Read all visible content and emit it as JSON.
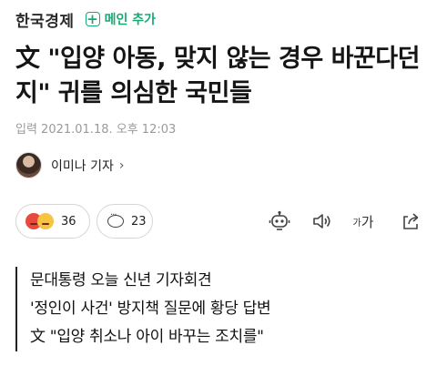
{
  "header": {
    "logo": "한국경제",
    "add_main_icon": "plus-icon",
    "add_main_label": "메인 추가",
    "accent_color": "#19a974"
  },
  "article": {
    "headline": "文 \"입양 아동, 맞지 않는 경우 바꾼다던지\" 귀를 의심한 국민들",
    "date": "입력 2021.01.18. 오후 12:03",
    "author": {
      "name": "이미나 기자",
      "chevron": "›"
    }
  },
  "actions": {
    "reactions": {
      "icons": [
        "angry-face-icon",
        "laughing-face-icon"
      ],
      "count": "36"
    },
    "comments": {
      "icon": "speech-bubble-icon",
      "count": "23"
    },
    "tools": [
      {
        "name": "robot-summary-icon"
      },
      {
        "name": "speaker-icon"
      },
      {
        "name": "font-size-icon",
        "label_small": "가",
        "label_large": "가"
      },
      {
        "name": "share-icon"
      }
    ]
  },
  "summary": {
    "lines": [
      "문대통령 오늘 신년 기자회견",
      "'정인이 사건' 방지책 질문에 황당 답변",
      "文 \"입양 취소나 아이 바꾸는 조치를\""
    ]
  }
}
